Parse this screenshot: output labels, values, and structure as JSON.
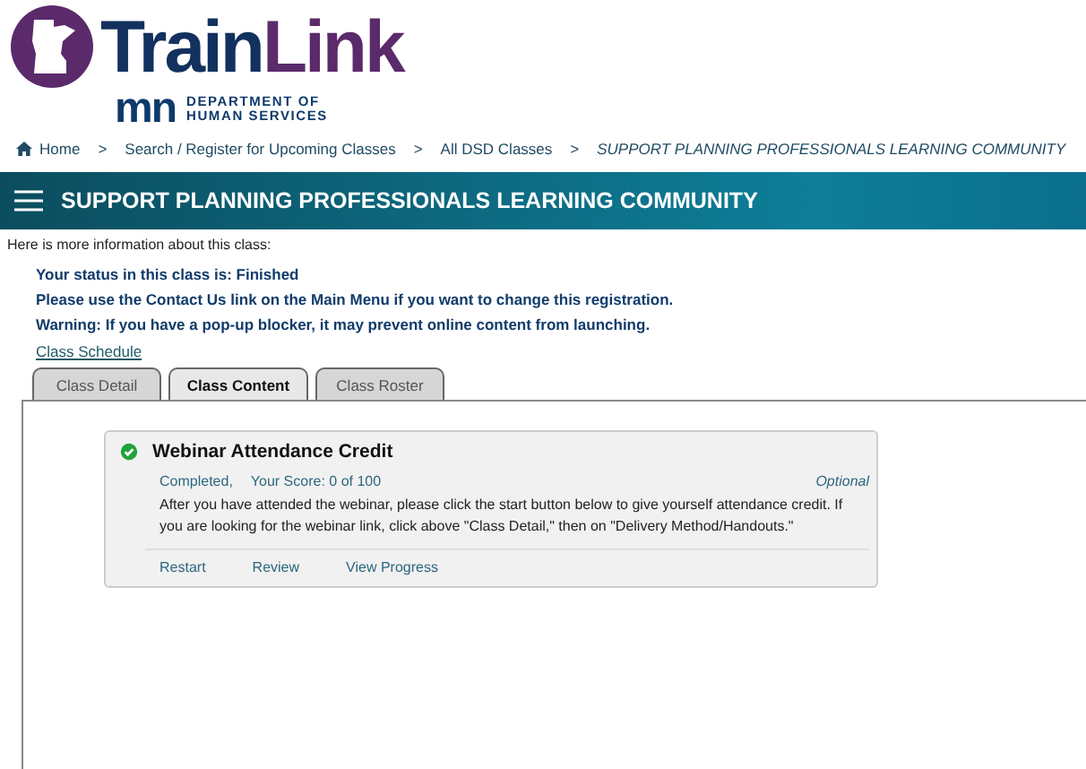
{
  "logo": {
    "brand_first": "Train",
    "brand_second": "Link",
    "agency_mark": "mn",
    "agency_lines": [
      "DEPARTMENT OF",
      "HUMAN SERVICES"
    ]
  },
  "breadcrumb": [
    {
      "label": "Home",
      "current": false
    },
    {
      "label": "Search / Register for Upcoming Classes",
      "current": false
    },
    {
      "label": "All DSD Classes",
      "current": false
    },
    {
      "label": "SUPPORT PLANNING PROFESSIONALS LEARNING COMMUNITY",
      "current": true
    }
  ],
  "breadcrumb_separator": ">",
  "header": {
    "title": "SUPPORT PLANNING PROFESSIONALS LEARNING COMMUNITY"
  },
  "intro": "Here is more information about this class:",
  "notices": [
    "Your status in this class is: Finished",
    "Please use the Contact Us link on the Main Menu if you want to change this registration.",
    "Warning: If you have a pop-up blocker, it may prevent online content from launching."
  ],
  "schedule_link": "Class Schedule",
  "tabs": [
    {
      "label": "Class Detail",
      "selected": false
    },
    {
      "label": "Class Content",
      "selected": true
    },
    {
      "label": "Class Roster",
      "selected": false
    }
  ],
  "content_items": [
    {
      "title": "Webinar Attendance Credit",
      "completed": true,
      "status": "Completed,",
      "score": "Your Score: 0 of 100",
      "optional": "Optional",
      "description": "After you have attended the webinar, please click the start button below to give yourself attendance credit. If you are looking for the webinar link, click above \"Class Detail,\" then on \"Delivery Method/Handouts.\"",
      "actions": [
        "Restart",
        "Review",
        "View Progress"
      ]
    }
  ]
}
